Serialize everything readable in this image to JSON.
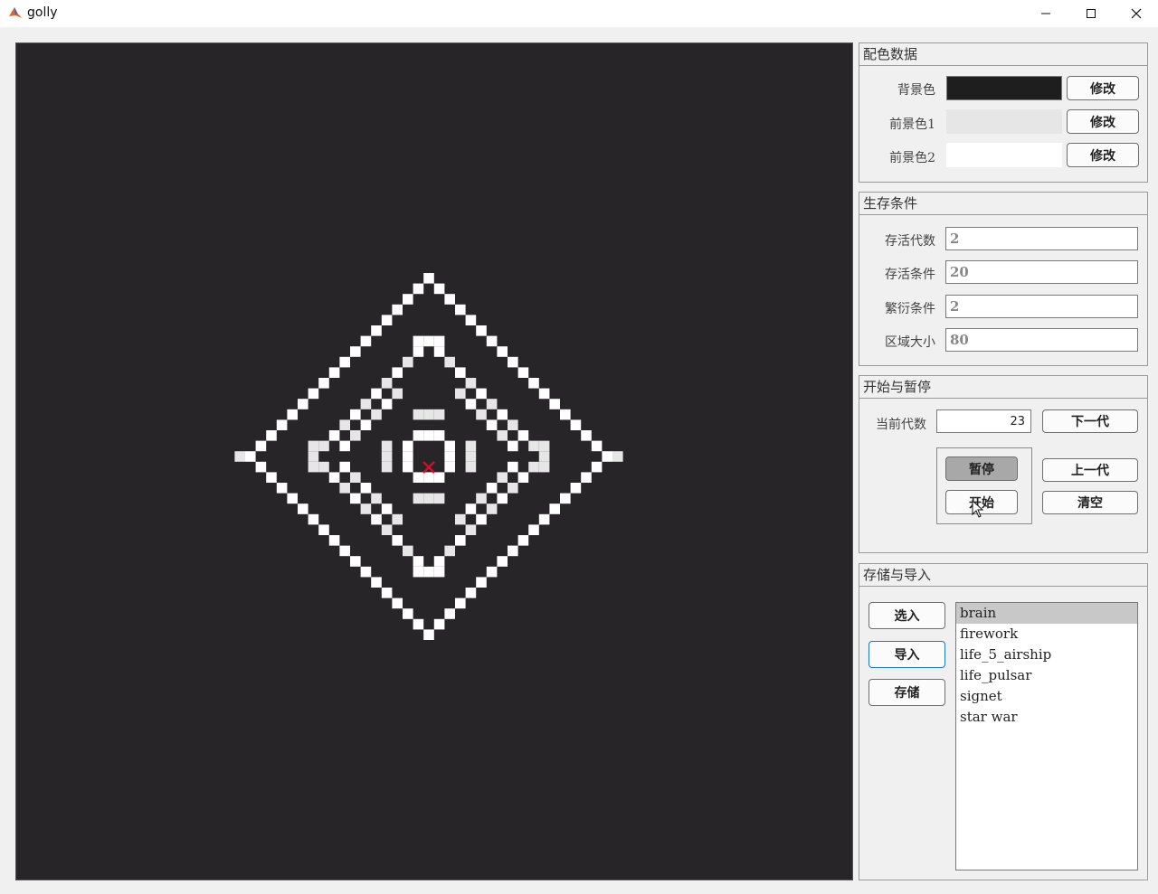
{
  "window": {
    "title": "golly"
  },
  "colors": {
    "background": "#1f1e1f",
    "foreground1": "#e6e6e6",
    "foreground2": "#ffffff"
  },
  "color_panel": {
    "title": "配色数据",
    "rows": [
      {
        "label": "背景色",
        "button": "修改"
      },
      {
        "label": "前景色1",
        "button": "修改"
      },
      {
        "label": "前景色2",
        "button": "修改"
      }
    ]
  },
  "survival_panel": {
    "title": "生存条件",
    "rows": [
      {
        "label": "存活代数",
        "value": "2"
      },
      {
        "label": "存活条件",
        "value": "20"
      },
      {
        "label": "繁衍条件",
        "value": "2"
      },
      {
        "label": "区域大小",
        "value": "80"
      }
    ]
  },
  "control_panel": {
    "title": "开始与暂停",
    "generation_label": "当前代数",
    "generation_value": "23",
    "next_label": "下一代",
    "pause_label": "暂停",
    "prev_label": "上一代",
    "start_label": "开始",
    "clear_label": "清空"
  },
  "storage_panel": {
    "title": "存储与导入",
    "select_label": "选入",
    "import_label": "导入",
    "save_label": "存储",
    "files": [
      "brain",
      "firework",
      "life_5_airship",
      "life_pulsar",
      "signet",
      "star war"
    ],
    "selected_index": 0
  }
}
